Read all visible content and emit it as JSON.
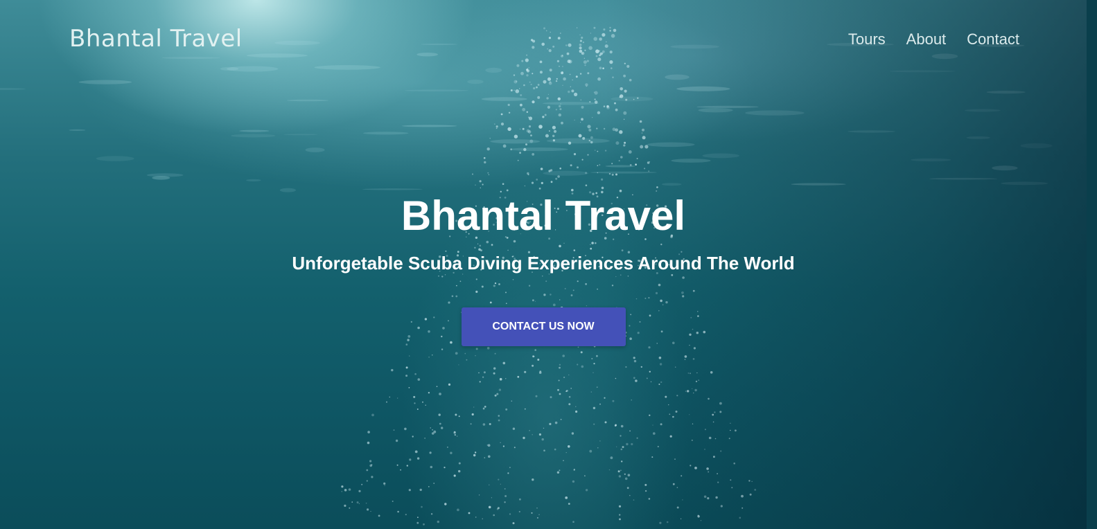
{
  "nav": {
    "brand": "Bhantal Travel",
    "links": [
      "Tours",
      "About",
      "Contact"
    ]
  },
  "hero": {
    "title": "Bhantal Travel",
    "subtitle": "Unforgetable Scuba Diving Experiences Around The World",
    "cta_label": "CONTACT US NOW"
  },
  "colors": {
    "cta_background": "#4451b8",
    "water_dark": "#0b4d5a",
    "water_light": "#3f8c98"
  }
}
